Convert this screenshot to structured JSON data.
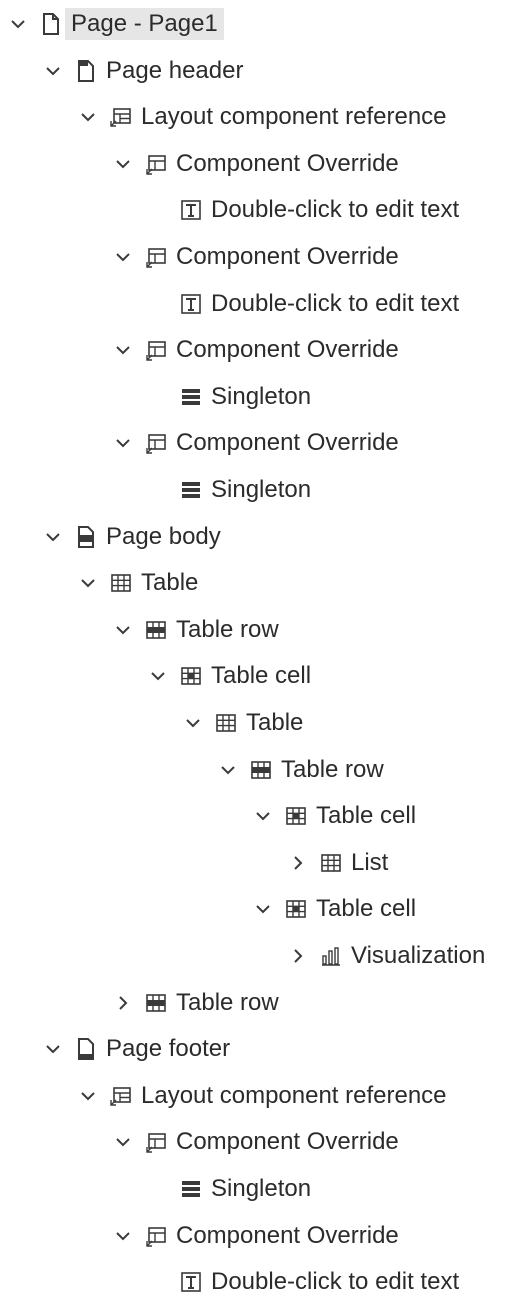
{
  "tree": [
    {
      "id": "r0",
      "depth": 0,
      "expand": "open",
      "icon": "page-icon",
      "label": "Page - Page1",
      "selected": true
    },
    {
      "id": "r1",
      "depth": 1,
      "expand": "open",
      "icon": "page-header-icon",
      "label": "Page header"
    },
    {
      "id": "r2",
      "depth": 2,
      "expand": "open",
      "icon": "layout-component-reference-icon",
      "label": "Layout component reference"
    },
    {
      "id": "r3",
      "depth": 3,
      "expand": "open",
      "icon": "component-override-icon",
      "label": "Component Override"
    },
    {
      "id": "r4",
      "depth": 4,
      "expand": "none",
      "icon": "text-item-icon",
      "label": "Double-click to edit text"
    },
    {
      "id": "r5",
      "depth": 3,
      "expand": "open",
      "icon": "component-override-icon",
      "label": "Component Override"
    },
    {
      "id": "r6",
      "depth": 4,
      "expand": "none",
      "icon": "text-item-icon",
      "label": "Double-click to edit text"
    },
    {
      "id": "r7",
      "depth": 3,
      "expand": "open",
      "icon": "component-override-icon",
      "label": "Component Override"
    },
    {
      "id": "r8",
      "depth": 4,
      "expand": "none",
      "icon": "singleton-icon",
      "label": "Singleton"
    },
    {
      "id": "r9",
      "depth": 3,
      "expand": "open",
      "icon": "component-override-icon",
      "label": "Component Override"
    },
    {
      "id": "r10",
      "depth": 4,
      "expand": "none",
      "icon": "singleton-icon",
      "label": "Singleton"
    },
    {
      "id": "r11",
      "depth": 1,
      "expand": "open",
      "icon": "page-body-icon",
      "label": "Page body"
    },
    {
      "id": "r12",
      "depth": 2,
      "expand": "open",
      "icon": "table-icon",
      "label": "Table"
    },
    {
      "id": "r13",
      "depth": 3,
      "expand": "open",
      "icon": "table-row-icon",
      "label": "Table row"
    },
    {
      "id": "r14",
      "depth": 4,
      "expand": "open",
      "icon": "table-cell-icon",
      "label": "Table cell"
    },
    {
      "id": "r15",
      "depth": 5,
      "expand": "open",
      "icon": "table-icon",
      "label": "Table"
    },
    {
      "id": "r16",
      "depth": 6,
      "expand": "open",
      "icon": "table-row-icon",
      "label": "Table row"
    },
    {
      "id": "r17",
      "depth": 7,
      "expand": "open",
      "icon": "table-cell-icon",
      "label": "Table cell"
    },
    {
      "id": "r18",
      "depth": 8,
      "expand": "closed",
      "icon": "list-icon",
      "label": "List"
    },
    {
      "id": "r19",
      "depth": 7,
      "expand": "open",
      "icon": "table-cell-icon",
      "label": "Table cell"
    },
    {
      "id": "r20",
      "depth": 8,
      "expand": "closed",
      "icon": "visualization-icon",
      "label": "Visualization"
    },
    {
      "id": "r21",
      "depth": 3,
      "expand": "closed",
      "icon": "table-row-icon",
      "label": "Table row"
    },
    {
      "id": "r22",
      "depth": 1,
      "expand": "open",
      "icon": "page-footer-icon",
      "label": "Page footer"
    },
    {
      "id": "r23",
      "depth": 2,
      "expand": "open",
      "icon": "layout-component-reference-icon",
      "label": "Layout component reference"
    },
    {
      "id": "r24",
      "depth": 3,
      "expand": "open",
      "icon": "component-override-icon",
      "label": "Component Override"
    },
    {
      "id": "r25",
      "depth": 4,
      "expand": "none",
      "icon": "singleton-icon",
      "label": "Singleton"
    },
    {
      "id": "r26",
      "depth": 3,
      "expand": "open",
      "icon": "component-override-icon",
      "label": "Component Override"
    },
    {
      "id": "r27",
      "depth": 4,
      "expand": "none",
      "icon": "text-item-icon",
      "label": "Double-click to edit text"
    }
  ]
}
